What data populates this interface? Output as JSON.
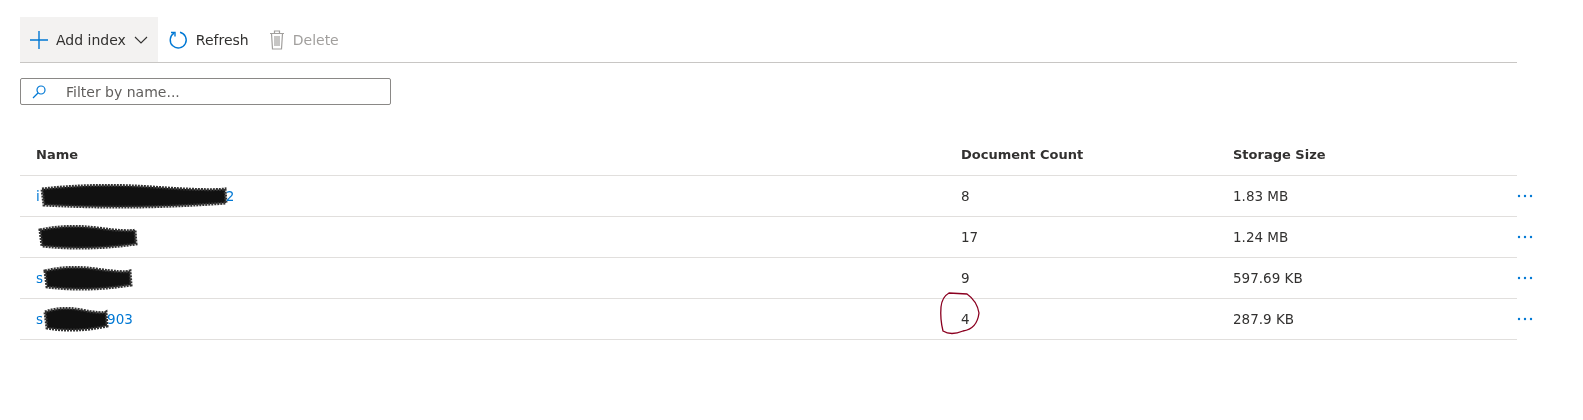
{
  "toolbar": {
    "buttons": [
      {
        "kind": "add",
        "label": "Add index",
        "highlighted": true,
        "disabled": false
      },
      {
        "kind": "refresh",
        "label": "Refresh",
        "highlighted": false,
        "disabled": false
      },
      {
        "kind": "delete",
        "label": "Delete",
        "highlighted": false,
        "disabled": true
      }
    ]
  },
  "filter": {
    "placeholder": "Filter by name..."
  },
  "table": {
    "columns": [
      "Name",
      "Document Count",
      "Storage Size"
    ],
    "rows": [
      {
        "name_head": "i",
        "name_tail": "2",
        "redacted": true,
        "document_count": "8",
        "storage_size": "1.83 MB",
        "circled": false
      },
      {
        "redacted": true,
        "document_count": "17",
        "storage_size": "1.24 MB",
        "circled": false
      },
      {
        "name_head": "s",
        "redacted": true,
        "document_count": "9",
        "storage_size": "597.69 KB",
        "circled": false
      },
      {
        "name_head": "s",
        "name_tail": "903",
        "redacted": true,
        "document_count": "4",
        "storage_size": "287.9 KB",
        "circled": true
      }
    ]
  }
}
